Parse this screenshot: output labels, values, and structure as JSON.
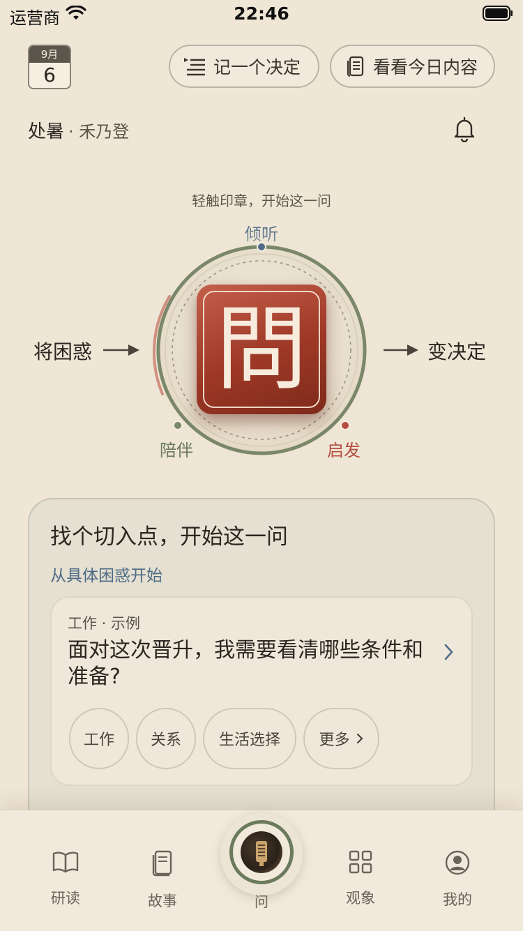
{
  "status_bar": {
    "carrier": "运营商",
    "time": "22:46"
  },
  "header": {
    "calendar": {
      "month": "9月",
      "day": "6"
    },
    "record_decision_label": "记一个决定",
    "today_content_label": "看看今日内容",
    "solar_term": "处暑",
    "solar_sub": "· 禾乃登"
  },
  "seal": {
    "hint": "轻触印章，开始这一问",
    "top_label": "倾听",
    "left_label": "将困惑",
    "right_label": "变决定",
    "bottom_left_label": "陪伴",
    "bottom_right_label": "启发",
    "character": "問"
  },
  "card": {
    "title": "找个切入点，开始这一问",
    "subtitle": "从具体困惑开始",
    "example": {
      "tag": "工作 · 示例",
      "question": "面对这次晋升，我需要看清哪些条件和准备?"
    },
    "chips": [
      "工作",
      "关系",
      "生活选择",
      "更多"
    ]
  },
  "tabbar": {
    "tabs": [
      "研读",
      "故事",
      "问",
      "观象",
      "我的"
    ]
  },
  "colors": {
    "background": "#efe6d6",
    "seal_red": "#a03b29",
    "ring_green": "#7a8769",
    "accent_blue": "#4e6b86",
    "accent_red": "#b54d3e"
  }
}
